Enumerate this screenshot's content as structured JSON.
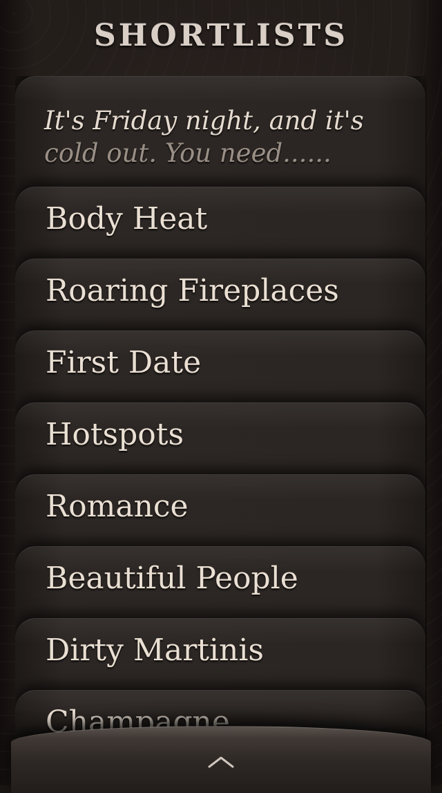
{
  "header": {
    "title": "SHORTLISTS"
  },
  "intro": {
    "line1": "It's Friday night, and it's",
    "line2": "cold out. You need......"
  },
  "shortlists": [
    {
      "label": "Body Heat"
    },
    {
      "label": "Roaring Fireplaces"
    },
    {
      "label": "First Date"
    },
    {
      "label": "Hotspots"
    },
    {
      "label": "Romance"
    },
    {
      "label": "Beautiful People"
    },
    {
      "label": "Dirty Martinis"
    },
    {
      "label": "Champagne"
    }
  ],
  "bottom_bar": {
    "icon": "chevron-up-icon"
  },
  "colors": {
    "background": "#1a1614",
    "card": "#2b2623",
    "text": "#eadfd3",
    "muted_text": "#9a8f86"
  }
}
